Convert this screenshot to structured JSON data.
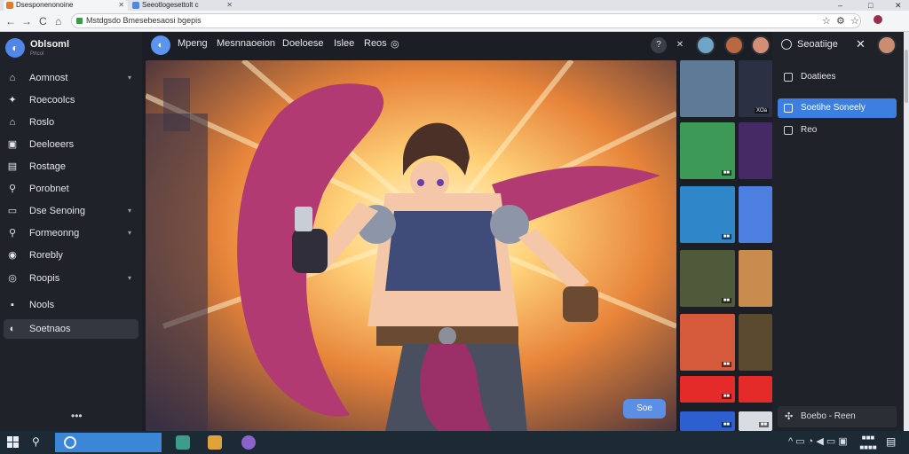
{
  "browser": {
    "tabs": [
      {
        "label": "Dsesponenonoine",
        "active": true
      },
      {
        "label": "Seeotlogesettolt c",
        "active": false
      }
    ],
    "address": "Mstdgsdo Bmesebesaosi bgepis",
    "nav_back": "←",
    "nav_forward": "→",
    "nav_reload": "C",
    "nav_home": "⌂",
    "window_min": "–",
    "window_max": "□",
    "window_close": "✕",
    "star_icon": "☆",
    "ext_icon": "⚙",
    "bookmark_icon": "☆"
  },
  "sidebar": {
    "brand_name": "Oblsoml",
    "brand_sub": "Prtcol",
    "items": [
      {
        "label": "Aomnost",
        "icon": "home-icon",
        "glyph": "⌂",
        "chevron": "▾"
      },
      {
        "label": "Roecoolcs",
        "icon": "compass-icon",
        "glyph": "✦",
        "chevron": ""
      },
      {
        "label": "Roslo",
        "icon": "bookmark-icon",
        "glyph": "⌂",
        "chevron": ""
      },
      {
        "label": "Deeloeers",
        "icon": "monitor-icon",
        "glyph": "▣",
        "chevron": ""
      },
      {
        "label": "Rostage",
        "icon": "storage-icon",
        "glyph": "▤",
        "chevron": ""
      },
      {
        "label": "Porobnet",
        "icon": "search-icon",
        "glyph": "⚲",
        "chevron": ""
      },
      {
        "label": "Dse Senoing",
        "icon": "tv-icon",
        "glyph": "▭",
        "chevron": "▾"
      },
      {
        "label": "Formeonng",
        "icon": "pin-icon",
        "glyph": "⚲",
        "chevron": "▾"
      },
      {
        "label": "Rorebly",
        "icon": "globe-icon",
        "glyph": "◉",
        "chevron": ""
      },
      {
        "label": "Roopis",
        "icon": "target-icon",
        "glyph": "◎",
        "chevron": "▾"
      },
      {
        "label": "Nools",
        "icon": "tools-icon",
        "glyph": "▪",
        "chevron": ""
      },
      {
        "label": "Soetnaos",
        "icon": "settings-icon",
        "glyph": "◐",
        "chevron": ""
      }
    ],
    "more": "•••"
  },
  "header": {
    "nav": [
      "Mpeng",
      "Mesnnaoeion",
      "Doeloese",
      "Islee",
      "Reos"
    ],
    "camera_icon": "◎",
    "help_icon": "?",
    "close_icon": "✕"
  },
  "hero": {
    "button_label": "Soe"
  },
  "thumbnails": {
    "tags": [
      "XOa",
      "■■",
      "■■",
      "■■",
      "■■",
      "■■",
      "■■",
      "■■"
    ]
  },
  "right_panel": {
    "title": "Seoatiige",
    "close": "✕",
    "items": [
      {
        "label": "Doatiees",
        "active": false
      },
      {
        "label": "Soetihe Soneely",
        "active": true
      },
      {
        "label": "Reo",
        "active": false
      }
    ],
    "footer_label": "Boebo - Reen",
    "footer_icon": "✣"
  },
  "taskbar": {
    "search_icon": "⚲",
    "tray": "^ ▭ ◔ ◀ ▭ ▣",
    "clock_time": "■■■",
    "clock_date": "■■■■",
    "notif_icon": "▤"
  },
  "colors": {
    "accent": "#3d7fe0",
    "background": "#1b1e24",
    "sidebar": "#1f2228"
  }
}
